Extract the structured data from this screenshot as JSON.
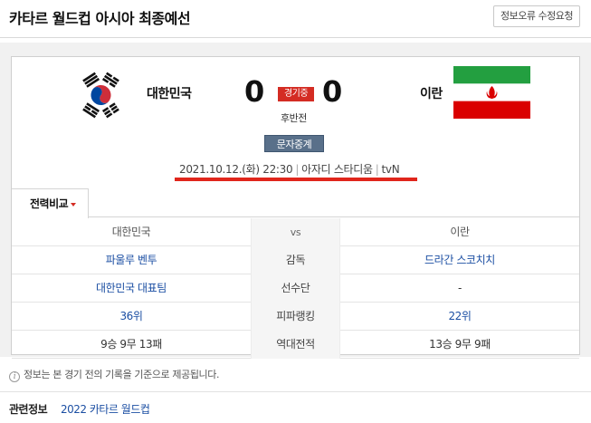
{
  "header": {
    "title": "카타르 월드컵 아시아 최종예선",
    "report_button": "정보오류 수정요청"
  },
  "match": {
    "home_team": "대한민국",
    "away_team": "이란",
    "home_score": "0",
    "away_score": "0",
    "status": "경기중",
    "period": "후반전",
    "text_relay_button": "문자중계",
    "datetime": "2021.10.12.(화) 22:30",
    "venue": "아자디 스타디움",
    "broadcaster": "tvN",
    "home_flag_icon": "south-korea-flag-icon",
    "away_flag_icon": "iran-flag-icon"
  },
  "tabs": {
    "active_label": "전력비교"
  },
  "comparison": {
    "header": {
      "home": "대한민국",
      "mid": "vs",
      "away": "이란"
    },
    "rows": [
      {
        "label": "감독",
        "home": "파울루 벤투",
        "away": "드라간 스코치치"
      },
      {
        "label": "선수단",
        "home": "대한민국 대표팀",
        "away": "-"
      },
      {
        "label": "피파랭킹",
        "home": "36위",
        "away": "22위"
      },
      {
        "label": "역대전적",
        "home": "9승 9무 13패",
        "away": "13승 9무 9패"
      }
    ]
  },
  "footer": {
    "note": "정보는 본 경기 전의 기록을 기준으로 제공됩니다.",
    "related_label": "관련정보",
    "related_link": "2022 카타르 월드컵"
  },
  "colors": {
    "accent_red": "#d42c23",
    "link_blue": "#1c4fa3",
    "relay_button": "#59708a"
  }
}
